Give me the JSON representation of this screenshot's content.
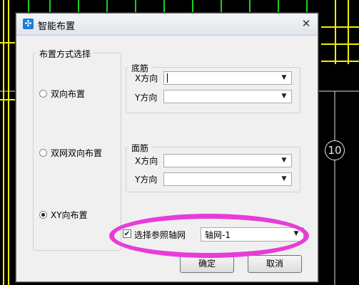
{
  "cad": {
    "axis_number": "10",
    "icons": [
      "cad-grid-lines"
    ]
  },
  "dialog": {
    "title": "智能布置",
    "title_icon": "arrange-icon",
    "close_glyph": "✕"
  },
  "layout_group": {
    "title": "布置方式选择",
    "options": [
      {
        "label": "双向布置",
        "checked": false
      },
      {
        "label": "双网双向布置",
        "checked": false
      },
      {
        "label": "XY向布置",
        "checked": true
      }
    ]
  },
  "bottom_bars": {
    "title": "底筋",
    "x_label": "X方向",
    "x_value": "",
    "y_label": "Y方向",
    "y_value": ""
  },
  "top_bars": {
    "title": "面筋",
    "x_label": "X方向",
    "x_value": "",
    "y_label": "Y方向",
    "y_value": ""
  },
  "axis_ref": {
    "checkbox_label": "选择参照轴网",
    "checked": true,
    "selected": "轴网-1"
  },
  "buttons": {
    "ok": "确定",
    "cancel": "取消"
  },
  "colors": {
    "highlight": "#e83cd8",
    "cad_yellow": "#f0f000",
    "cad_green": "#19d119"
  }
}
